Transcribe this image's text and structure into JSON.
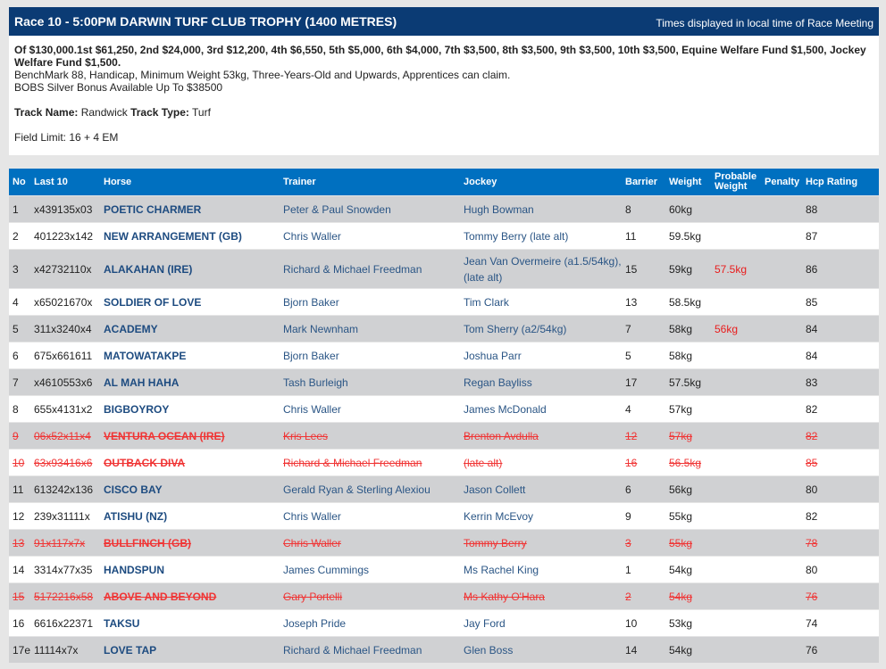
{
  "race": {
    "title": "Race 10 - 5:00PM DARWIN TURF CLUB TROPHY (1400 METRES)",
    "timezone_note": "Times displayed in local time of Race Meeting",
    "prize_line": "Of $130,000.1st $61,250, 2nd $24,000, 3rd $12,200, 4th $6,550, 5th $5,000, 6th $4,000, 7th $3,500, 8th $3,500, 9th $3,500, 10th $3,500, Equine Welfare Fund $1,500, Jockey Welfare Fund $1,500.",
    "conditions": "BenchMark 88, Handicap, Minimum Weight 53kg, Three-Years-Old and Upwards, Apprentices can claim.",
    "bonus": "BOBS Silver Bonus Available Up To $38500",
    "track_name_label": "Track Name:",
    "track_name": "Randwick",
    "track_type_label": "Track Type:",
    "track_type": "Turf",
    "field_limit": "Field Limit: 16 + 4 EM"
  },
  "colors": {
    "header_navy": "#0b3b74",
    "table_header_blue": "#0070c0",
    "row_gray": "#d0d1d3",
    "link_blue": "#1d4b80",
    "scratched_red": "#f03535"
  },
  "table": {
    "columns": [
      "No",
      "Last 10",
      "Horse",
      "Trainer",
      "Jockey",
      "Barrier",
      "Weight",
      "Probable Weight",
      "Penalty",
      "Hcp Rating"
    ],
    "rows": [
      {
        "no": "1",
        "last10": "x439135x03",
        "horse": "POETIC CHARMER",
        "trainer": "Peter & Paul Snowden",
        "jockey": "Hugh Bowman",
        "barrier": "8",
        "weight": "60kg",
        "prob_weight": "",
        "penalty": "",
        "hcp": "88",
        "scratched": false
      },
      {
        "no": "2",
        "last10": "401223x142",
        "horse": "NEW ARRANGEMENT (GB)",
        "trainer": "Chris Waller",
        "jockey": "Tommy Berry (late alt)",
        "barrier": "11",
        "weight": "59.5kg",
        "prob_weight": "",
        "penalty": "",
        "hcp": "87",
        "scratched": false
      },
      {
        "no": "3",
        "last10": "x42732110x",
        "horse": "ALAKAHAN (IRE)",
        "trainer": "Richard & Michael Freedman",
        "jockey": "Jean Van Overmeire (a1.5/54kg), (late alt)",
        "barrier": "15",
        "weight": "59kg",
        "prob_weight": "57.5kg",
        "penalty": "",
        "hcp": "86",
        "scratched": false
      },
      {
        "no": "4",
        "last10": "x65021670x",
        "horse": "SOLDIER OF LOVE",
        "trainer": "Bjorn Baker",
        "jockey": "Tim Clark",
        "barrier": "13",
        "weight": "58.5kg",
        "prob_weight": "",
        "penalty": "",
        "hcp": "85",
        "scratched": false
      },
      {
        "no": "5",
        "last10": "311x3240x4",
        "horse": "ACADEMY",
        "trainer": "Mark Newnham",
        "jockey": "Tom Sherry (a2/54kg)",
        "barrier": "7",
        "weight": "58kg",
        "prob_weight": "56kg",
        "penalty": "",
        "hcp": "84",
        "scratched": false
      },
      {
        "no": "6",
        "last10": "675x661611",
        "horse": "MATOWATAKPE",
        "trainer": "Bjorn Baker",
        "jockey": "Joshua Parr",
        "barrier": "5",
        "weight": "58kg",
        "prob_weight": "",
        "penalty": "",
        "hcp": "84",
        "scratched": false
      },
      {
        "no": "7",
        "last10": "x4610553x6",
        "horse": "AL MAH HAHA",
        "trainer": "Tash Burleigh",
        "jockey": "Regan Bayliss",
        "barrier": "17",
        "weight": "57.5kg",
        "prob_weight": "",
        "penalty": "",
        "hcp": "83",
        "scratched": false
      },
      {
        "no": "8",
        "last10": "655x4131x2",
        "horse": "BIGBOYROY",
        "trainer": "Chris Waller",
        "jockey": "James McDonald",
        "barrier": "4",
        "weight": "57kg",
        "prob_weight": "",
        "penalty": "",
        "hcp": "82",
        "scratched": false
      },
      {
        "no": "9",
        "last10": "06x52x11x4",
        "horse": "VENTURA OCEAN (IRE)",
        "trainer": "Kris Lees",
        "jockey": "Brenton Avdulla",
        "barrier": "12",
        "weight": "57kg",
        "prob_weight": "",
        "penalty": "",
        "hcp": "82",
        "scratched": true
      },
      {
        "no": "10",
        "last10": "63x93416x6",
        "horse": "OUTBACK DIVA",
        "trainer": "Richard & Michael Freedman",
        "jockey": "(late alt)",
        "barrier": "16",
        "weight": "56.5kg",
        "prob_weight": "",
        "penalty": "",
        "hcp": "85",
        "scratched": true
      },
      {
        "no": "11",
        "last10": "613242x136",
        "horse": "CISCO BAY",
        "trainer": "Gerald Ryan & Sterling Alexiou",
        "jockey": "Jason Collett",
        "barrier": "6",
        "weight": "56kg",
        "prob_weight": "",
        "penalty": "",
        "hcp": "80",
        "scratched": false
      },
      {
        "no": "12",
        "last10": "239x31111x",
        "horse": "ATISHU (NZ)",
        "trainer": "Chris Waller",
        "jockey": "Kerrin McEvoy",
        "barrier": "9",
        "weight": "55kg",
        "prob_weight": "",
        "penalty": "",
        "hcp": "82",
        "scratched": false
      },
      {
        "no": "13",
        "last10": "91x117x7x",
        "horse": "BULLFINCH (GB)",
        "trainer": "Chris Waller",
        "jockey": "Tommy Berry",
        "barrier": "3",
        "weight": "55kg",
        "prob_weight": "",
        "penalty": "",
        "hcp": "78",
        "scratched": true
      },
      {
        "no": "14",
        "last10": "3314x77x35",
        "horse": "HANDSPUN",
        "trainer": "James Cummings",
        "jockey": "Ms Rachel King",
        "barrier": "1",
        "weight": "54kg",
        "prob_weight": "",
        "penalty": "",
        "hcp": "80",
        "scratched": false
      },
      {
        "no": "15",
        "last10": "5172216x58",
        "horse": "ABOVE AND BEYOND",
        "trainer": "Gary Portelli",
        "jockey": "Ms Kathy O'Hara",
        "barrier": "2",
        "weight": "54kg",
        "prob_weight": "",
        "penalty": "",
        "hcp": "76",
        "scratched": true
      },
      {
        "no": "16",
        "last10": "6616x22371",
        "horse": "TAKSU",
        "trainer": "Joseph Pride",
        "jockey": "Jay Ford",
        "barrier": "10",
        "weight": "53kg",
        "prob_weight": "",
        "penalty": "",
        "hcp": "74",
        "scratched": false
      },
      {
        "no": "17e",
        "last10": "11114x7x",
        "horse": "LOVE TAP",
        "trainer": "Richard & Michael Freedman",
        "jockey": "Glen Boss",
        "barrier": "14",
        "weight": "54kg",
        "prob_weight": "",
        "penalty": "",
        "hcp": "76",
        "scratched": false
      }
    ]
  }
}
